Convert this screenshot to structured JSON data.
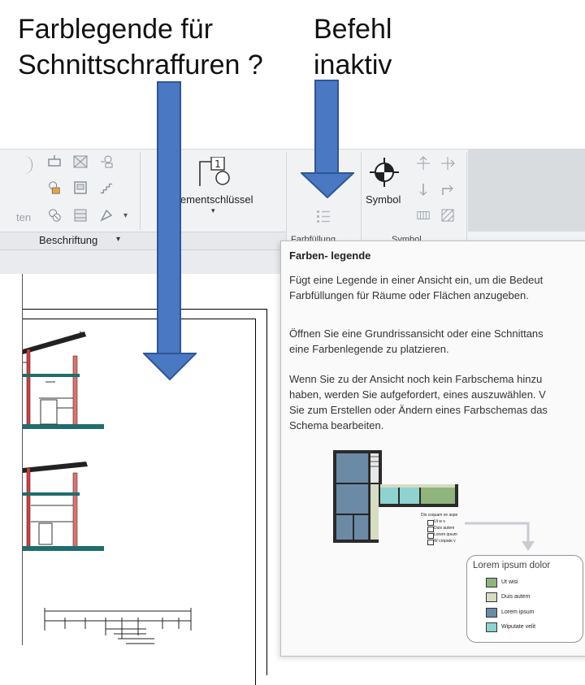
{
  "annotations": {
    "left_line1": "Farblegende für",
    "left_line2": "Schnittschraffuren ?",
    "right_line1": "Befehl",
    "right_line2": "inaktiv"
  },
  "ribbon": {
    "partial_label_left": "ten",
    "elementschluessel_label": "lementschlüssel",
    "symbol_label": "Symbol",
    "beschriftung_label": "Beschriftung",
    "farbfuellung_tab": "Farbfüllung",
    "symbol_tab": "Symbol"
  },
  "tooltip": {
    "title": "Farben- legende",
    "para1_line1": "Fügt eine Legende in einer Ansicht ein, um die Bedeut",
    "para1_line2": "Farbfüllungen für Räume oder Flächen anzugeben.",
    "para2_line1": "Öffnen Sie eine Grundrissansicht oder eine Schnittans",
    "para2_line2": "eine Farbenlegende zu platzieren.",
    "para3_line1": "Wenn Sie zu der Ansicht noch kein Farbschema hinzu",
    "para3_line2": "haben, werden Sie aufgefordert, eines auszuwählen. V",
    "para3_line3": "Sie zum Erstellen oder Ändern eines Farbschemas das",
    "para3_line4": "Schema bearbeiten."
  },
  "illustration": {
    "legend_title": "Lorem ipsum dolor",
    "legend_items": [
      {
        "label": "Ut wisi",
        "color": "#8fb47c"
      },
      {
        "label": "Duis autem",
        "color": "#d7dcc2"
      },
      {
        "label": "Lorem ipsum",
        "color": "#6b8aa6"
      },
      {
        "label": "Wiputate velit",
        "color": "#8fd3d0"
      }
    ],
    "small_legend_title": "Dis coquam ve aspe",
    "small_legend_items": [
      "Ut w s",
      "Duis autem",
      "Lorem ipsum",
      "W cropate v"
    ]
  },
  "colors": {
    "arrow_fill": "#4a78c2",
    "arrow_border": "#2f5597",
    "section_red": "#d9393c",
    "section_teal": "#1f6d6c"
  }
}
